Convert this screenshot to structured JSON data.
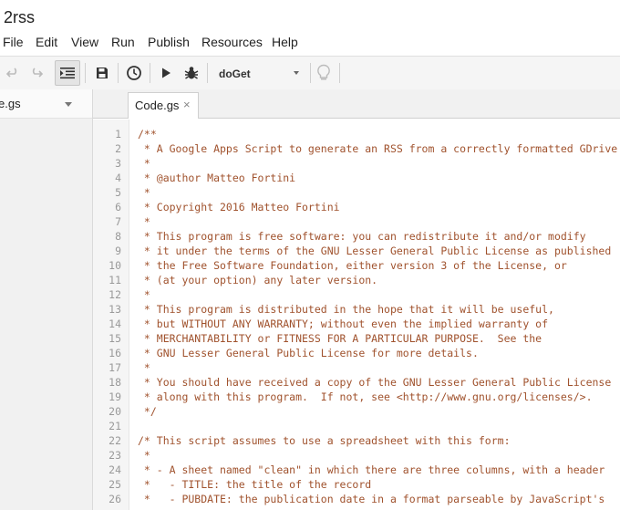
{
  "app": {
    "title": "2rss"
  },
  "menu": [
    "File",
    "Edit",
    "View",
    "Run",
    "Publish",
    "Resources",
    "Help"
  ],
  "toolbar": {
    "function_select": "doGet"
  },
  "file_panel": {
    "file_name": "e.gs"
  },
  "editor": {
    "tab_label": "Code.gs",
    "tab_close": "×",
    "lines": [
      {
        "n": "1",
        "text": "/**"
      },
      {
        "n": "2",
        "text": " * A Google Apps Script to generate an RSS from a correctly formatted GDrive"
      },
      {
        "n": "3",
        "text": " *"
      },
      {
        "n": "4",
        "text": " * @author Matteo Fortini"
      },
      {
        "n": "5",
        "text": " *"
      },
      {
        "n": "6",
        "text": " * Copyright 2016 Matteo Fortini"
      },
      {
        "n": "7",
        "text": " *"
      },
      {
        "n": "8",
        "text": " * This program is free software: you can redistribute it and/or modify"
      },
      {
        "n": "9",
        "text": " * it under the terms of the GNU Lesser General Public License as published"
      },
      {
        "n": "10",
        "text": " * the Free Software Foundation, either version 3 of the License, or"
      },
      {
        "n": "11",
        "text": " * (at your option) any later version."
      },
      {
        "n": "12",
        "text": " *"
      },
      {
        "n": "13",
        "text": " * This program is distributed in the hope that it will be useful,"
      },
      {
        "n": "14",
        "text": " * but WITHOUT ANY WARRANTY; without even the implied warranty of"
      },
      {
        "n": "15",
        "text": " * MERCHANTABILITY or FITNESS FOR A PARTICULAR PURPOSE.  See the"
      },
      {
        "n": "16",
        "text": " * GNU Lesser General Public License for more details."
      },
      {
        "n": "17",
        "text": " *"
      },
      {
        "n": "18",
        "text": " * You should have received a copy of the GNU Lesser General Public License"
      },
      {
        "n": "19",
        "text": " * along with this program.  If not, see <http://www.gnu.org/licenses/>."
      },
      {
        "n": "20",
        "text": " */"
      },
      {
        "n": "21",
        "text": ""
      },
      {
        "n": "22",
        "text": "/* This script assumes to use a spreadsheet with this form:"
      },
      {
        "n": "23",
        "text": " *"
      },
      {
        "n": "24",
        "text": " * - A sheet named \"clean\" in which there are three columns, with a header"
      },
      {
        "n": "25",
        "text": " *   - TITLE: the title of the record"
      },
      {
        "n": "26",
        "text": " *   - PUBDATE: the publication date in a format parseable by JavaScript's"
      }
    ]
  },
  "colors": {
    "code_text": "#a0522d",
    "line_number": "#999999",
    "toolbar_bg": "#f5f5f5"
  }
}
